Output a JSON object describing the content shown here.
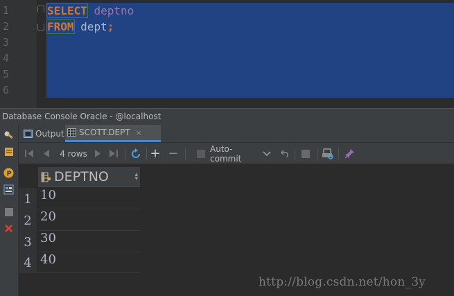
{
  "editor": {
    "line_numbers": [
      "1",
      "2",
      "3",
      "4",
      "5",
      "6"
    ],
    "line1": {
      "keyword": "SELECT",
      "ident": "deptno"
    },
    "line2": {
      "keyword": "FROM",
      "ident": "dept",
      "terminator": ";"
    },
    "colors": {
      "background": "#2b2b2b",
      "selection": "#214283",
      "keyword": "#cc7832",
      "identifier": "#9876aa"
    }
  },
  "console": {
    "title": "Database Console Oracle - @localhost",
    "tabs": [
      {
        "label": "Output",
        "icon": "console-icon"
      },
      {
        "label": "SCOTT.DEPT",
        "icon": "table-icon",
        "close": "×"
      }
    ]
  },
  "toolbar": {
    "rows_label": "4 rows",
    "autocommit_label": "Auto-commit",
    "add_glyph": "+",
    "remove_glyph": "−"
  },
  "grid": {
    "column_header": "DEPTNO",
    "row_numbers": [
      "1",
      "2",
      "3",
      "4"
    ],
    "rows": [
      "10",
      "20",
      "30",
      "40"
    ]
  },
  "watermark": "http://blog.csdn.net/hon_3y"
}
